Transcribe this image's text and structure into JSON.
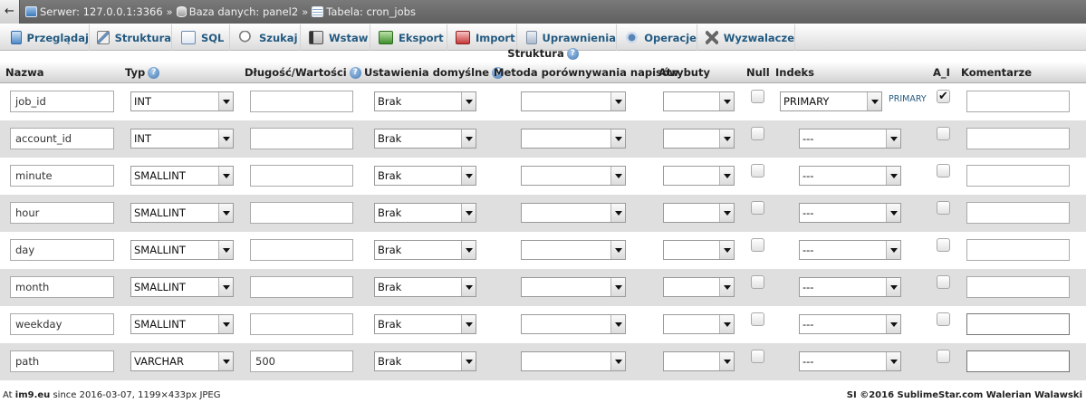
{
  "breadcrumb": {
    "back_label": "←",
    "server": "Serwer: 127.0.0.1:3366",
    "database": "Baza danych: panel2",
    "table": "Tabela: cron_jobs",
    "separator": "»"
  },
  "tabs": [
    {
      "label": "Przeglądaj",
      "icon": "browse-icon"
    },
    {
      "label": "Struktura",
      "icon": "structure-icon"
    },
    {
      "label": "SQL",
      "icon": "sql-icon"
    },
    {
      "label": "Szukaj",
      "icon": "search-icon"
    },
    {
      "label": "Wstaw",
      "icon": "insert-icon"
    },
    {
      "label": "Eksport",
      "icon": "export-icon"
    },
    {
      "label": "Import",
      "icon": "import-icon"
    },
    {
      "label": "Uprawnienia",
      "icon": "privileges-icon"
    },
    {
      "label": "Operacje",
      "icon": "operations-icon"
    },
    {
      "label": "Wyzwalacze",
      "icon": "triggers-icon"
    }
  ],
  "caption": "Struktura",
  "help_glyph": "?",
  "columns": {
    "name": "Nazwa",
    "type": "Typ",
    "length": "Długość/Wartości",
    "default": "Ustawienia domyślne",
    "collation": "Metoda porównywania napisów",
    "attributes": "Atrybuty",
    "null": "Null",
    "index": "Indeks",
    "ai": "A_I",
    "comment": "Komentarze"
  },
  "rows": [
    {
      "name": "job_id",
      "type": "INT",
      "length": "",
      "default": "Brak",
      "collation": "",
      "attributes": "",
      "null": false,
      "index": "PRIMARY",
      "index_link": "PRIMARY",
      "ai": true,
      "comment": ""
    },
    {
      "name": "account_id",
      "type": "INT",
      "length": "",
      "default": "Brak",
      "collation": "",
      "attributes": "",
      "null": false,
      "index": "---",
      "index_link": "",
      "ai": false,
      "comment": ""
    },
    {
      "name": "minute",
      "type": "SMALLINT",
      "length": "",
      "default": "Brak",
      "collation": "",
      "attributes": "",
      "null": false,
      "index": "---",
      "index_link": "",
      "ai": false,
      "comment": ""
    },
    {
      "name": "hour",
      "type": "SMALLINT",
      "length": "",
      "default": "Brak",
      "collation": "",
      "attributes": "",
      "null": false,
      "index": "---",
      "index_link": "",
      "ai": false,
      "comment": ""
    },
    {
      "name": "day",
      "type": "SMALLINT",
      "length": "",
      "default": "Brak",
      "collation": "",
      "attributes": "",
      "null": false,
      "index": "---",
      "index_link": "",
      "ai": false,
      "comment": ""
    },
    {
      "name": "month",
      "type": "SMALLINT",
      "length": "",
      "default": "Brak",
      "collation": "",
      "attributes": "",
      "null": false,
      "index": "---",
      "index_link": "",
      "ai": false,
      "comment": ""
    },
    {
      "name": "weekday",
      "type": "SMALLINT",
      "length": "",
      "default": "Brak",
      "collation": "",
      "attributes": "",
      "null": false,
      "index": "---",
      "index_link": "",
      "ai": false,
      "comment": ""
    },
    {
      "name": "path",
      "type": "VARCHAR",
      "length": "500",
      "default": "Brak",
      "collation": "",
      "attributes": "",
      "null": false,
      "index": "---",
      "index_link": "",
      "ai": false,
      "comment": ""
    }
  ],
  "footer": {
    "left_prefix": "At ",
    "left_site": "im9.eu",
    "left_suffix": " since 2016-03-07, 1199×433px JPEG",
    "right": "SI ©2016 SublimeStar.com Walerian Walawski"
  },
  "colors": {
    "link": "#235a81",
    "row_even": "#dfdfdf",
    "topbar": "#6b6b6b"
  }
}
